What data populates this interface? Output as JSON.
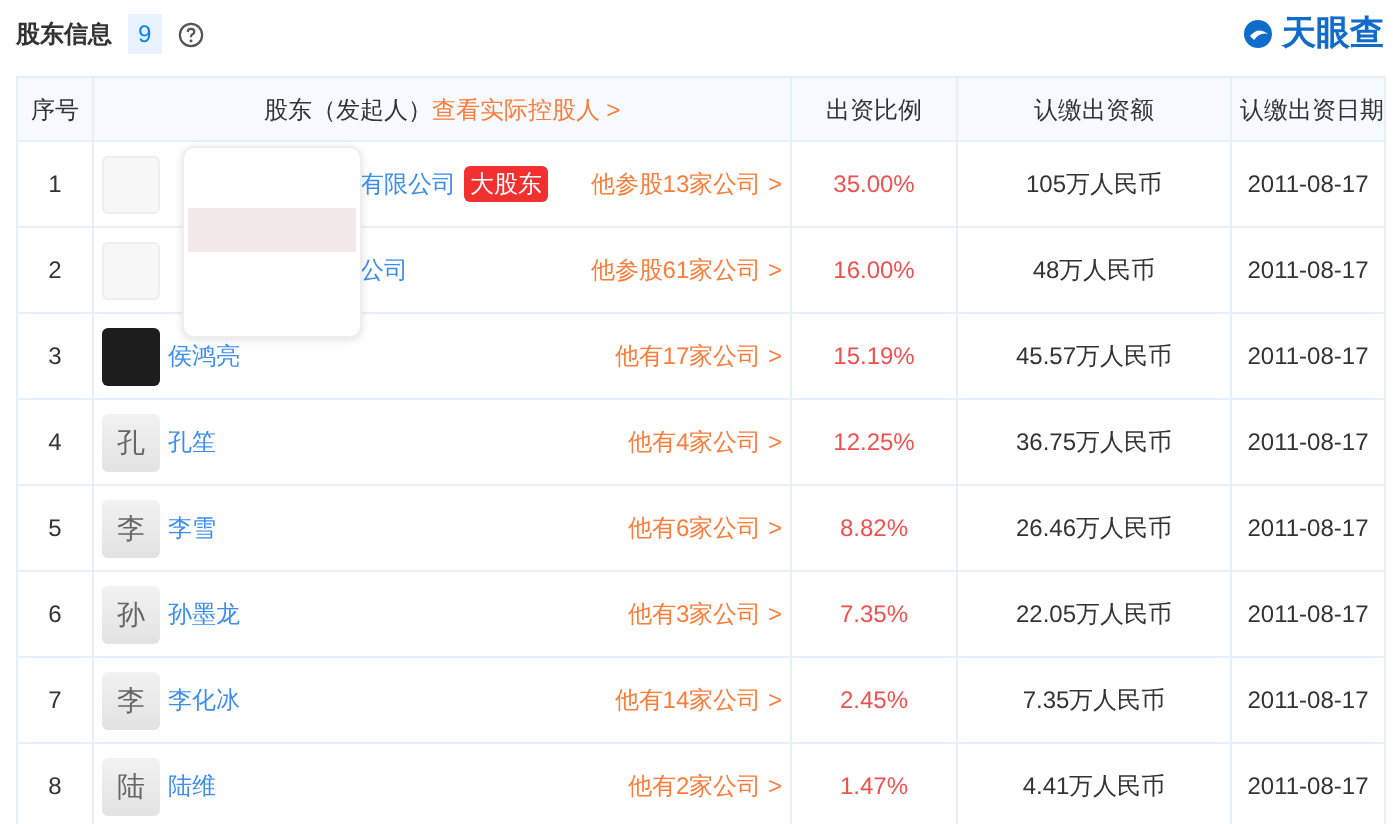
{
  "section": {
    "title": "股东信息",
    "count": "9",
    "help_icon": true
  },
  "brand": {
    "name": "天眼查"
  },
  "table": {
    "columns": [
      {
        "kind": "plain",
        "label": "序号"
      },
      {
        "kind": "link",
        "label": "股东（发起人）",
        "link": "查看实际控股人 >"
      },
      {
        "kind": "plain",
        "label": "出资比例"
      },
      {
        "kind": "plain",
        "label": "认缴出资额"
      },
      {
        "kind": "plain",
        "label": "认缴出资日期"
      }
    ],
    "rows": [
      {
        "index": "1",
        "kind": "logo",
        "logo_preview": true,
        "name": "有限公司",
        "covered": true,
        "tag": "大股东",
        "holdings": "他参股13家公司 >",
        "ratio": "35.00%",
        "amount": "105万人民币",
        "date": "2011-08-17"
      },
      {
        "index": "2",
        "kind": "logo",
        "name": "公司",
        "covered": true,
        "holdings": "他参股61家公司 >",
        "ratio": "16.00%",
        "amount": "48万人民币",
        "date": "2011-08-17"
      },
      {
        "index": "3",
        "kind": "photo",
        "name": "侯鸿亮",
        "holdings": "他有17家公司 >",
        "ratio": "15.19%",
        "amount": "45.57万人民币",
        "date": "2011-08-17"
      },
      {
        "index": "4",
        "kind": "letter",
        "avatar_text": "孔",
        "name": "孔笙",
        "holdings": "他有4家公司 >",
        "ratio": "12.25%",
        "amount": "36.75万人民币",
        "date": "2011-08-17"
      },
      {
        "index": "5",
        "kind": "letter",
        "avatar_text": "李",
        "name": "李雪",
        "holdings": "他有6家公司 >",
        "ratio": "8.82%",
        "amount": "26.46万人民币",
        "date": "2011-08-17"
      },
      {
        "index": "6",
        "kind": "letter",
        "avatar_text": "孙",
        "name": "孙墨龙",
        "holdings": "他有3家公司 >",
        "ratio": "7.35%",
        "amount": "22.05万人民币",
        "date": "2011-08-17"
      },
      {
        "index": "7",
        "kind": "letter",
        "avatar_text": "李",
        "name": "李化冰",
        "holdings": "他有14家公司 >",
        "ratio": "2.45%",
        "amount": "7.35万人民币",
        "date": "2011-08-17"
      },
      {
        "index": "8",
        "kind": "letter",
        "avatar_text": "陆",
        "name": "陆维",
        "holdings": "他有2家公司 >",
        "ratio": "1.47%",
        "amount": "4.41万人民币",
        "date": "2011-08-17"
      }
    ]
  }
}
